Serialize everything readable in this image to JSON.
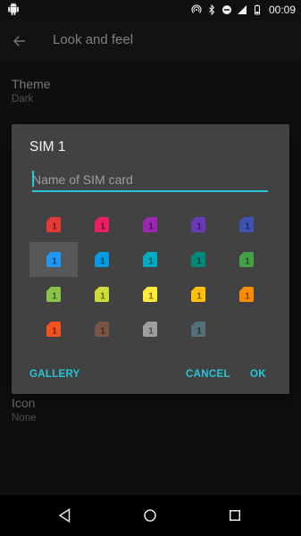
{
  "statusbar": {
    "time": "00:09"
  },
  "appbar": {
    "title": "Look and feel"
  },
  "settings": [
    {
      "label": "Theme",
      "value": "Dark"
    },
    {
      "label": "Icon",
      "value": "None"
    }
  ],
  "dialog": {
    "title": "SIM 1",
    "input_placeholder": "Name of SIM card",
    "input_value": "",
    "buttons": {
      "gallery": "GALLERY",
      "cancel": "CANCEL",
      "ok": "OK"
    },
    "icon_label": "1",
    "selected_index": 5,
    "colors": [
      "#e53935",
      "#e91e63",
      "#9c27b0",
      "#673ab7",
      "#3f51b5",
      "#2196f3",
      "#039be5",
      "#00acc1",
      "#00897b",
      "#43a047",
      "#8bc34a",
      "#cddc39",
      "#ffeb3b",
      "#ffc107",
      "#fb8c00",
      "#f4511e",
      "#795548",
      "#9e9e9e",
      "#546e7a"
    ]
  },
  "icons": {
    "back": "arrow-back-icon",
    "android": "android-icon",
    "nav": [
      "nav-back-icon",
      "nav-home-icon",
      "nav-recents-icon"
    ]
  }
}
